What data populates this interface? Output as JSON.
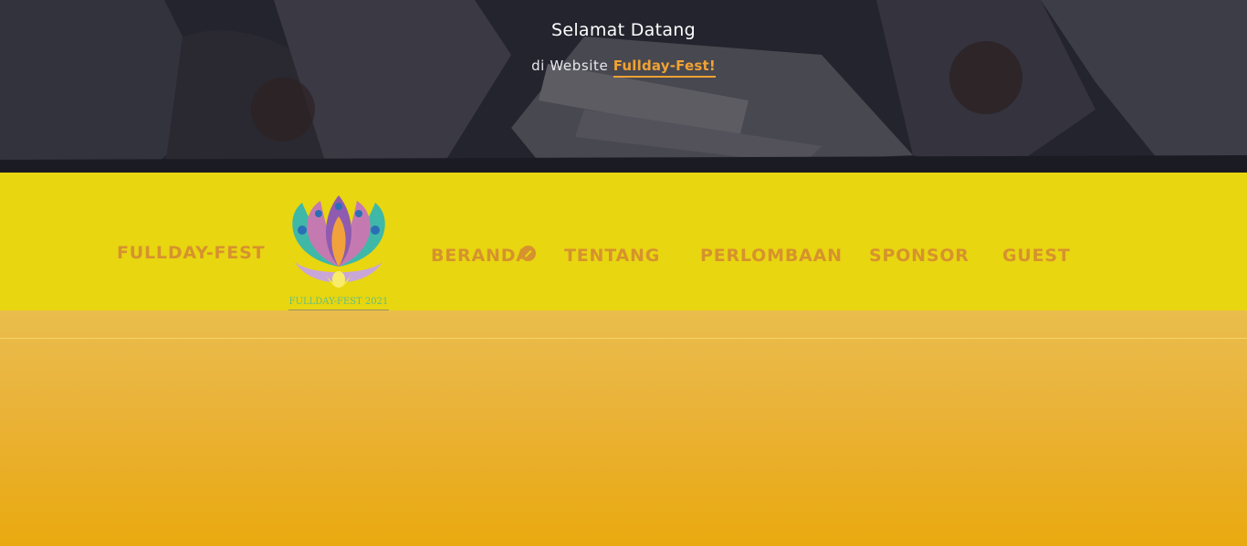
{
  "hero": {
    "title": "Selamat Datang",
    "subtitle_prefix": "di Website",
    "subtitle_brand": "Fullday-Fest!"
  },
  "navbar": {
    "brand": "FULLDAY-FEST",
    "items": [
      {
        "label": "BERANDA",
        "active": true
      },
      {
        "label": "TENTANG",
        "active": false
      },
      {
        "label": "PERLOMBAAN",
        "active": false
      },
      {
        "label": "SPONSOR",
        "active": false
      },
      {
        "label": "GUEST",
        "active": false
      }
    ],
    "logo_text": "FULLDAY-FEST 2021"
  },
  "colors": {
    "navbar_bg": "#e8d610",
    "nav_text": "#d6922e",
    "accent": "#f0a233",
    "page_bg": "#e9a90f"
  }
}
